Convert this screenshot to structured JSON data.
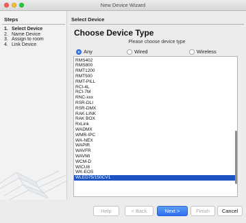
{
  "window": {
    "title": "New Device Wizard"
  },
  "steps": {
    "heading": "Steps",
    "items": [
      {
        "num": "1.",
        "label": "Select Device",
        "active": true
      },
      {
        "num": "2.",
        "label": "Name Device",
        "active": false
      },
      {
        "num": "3.",
        "label": "Assign to room",
        "active": false
      },
      {
        "num": "4.",
        "label": "Link Device",
        "active": false
      }
    ]
  },
  "main": {
    "section_heading": "Select Device",
    "title": "Choose Device Type",
    "hint": "Please choose device type",
    "filters": [
      {
        "label": "Any",
        "checked": true
      },
      {
        "label": "Wired",
        "checked": false
      },
      {
        "label": "Wireless",
        "checked": false
      }
    ],
    "devices": [
      "RMS402",
      "RMS800",
      "RMT1200",
      "RMT500",
      "RMT-PILL",
      "RCI-4L",
      "RCI-7M",
      "RNC-xxx",
      "RSR-DLI",
      "RSR-DMX",
      "RAK-LINK",
      "RAK BOX",
      "RxLink",
      "WADMX",
      "WMR-IPC",
      "WA-NEX",
      "WAPIR",
      "WAVFR",
      "WAVMI",
      "WCM-D",
      "WICU8",
      "WK-EOS",
      "WLED75/150CV1"
    ],
    "selected_device": "WLED75/150CV1"
  },
  "footer": {
    "help": "Help",
    "back": "< Back",
    "next": "Next >",
    "finish": "Finish",
    "cancel": "Cancel"
  }
}
